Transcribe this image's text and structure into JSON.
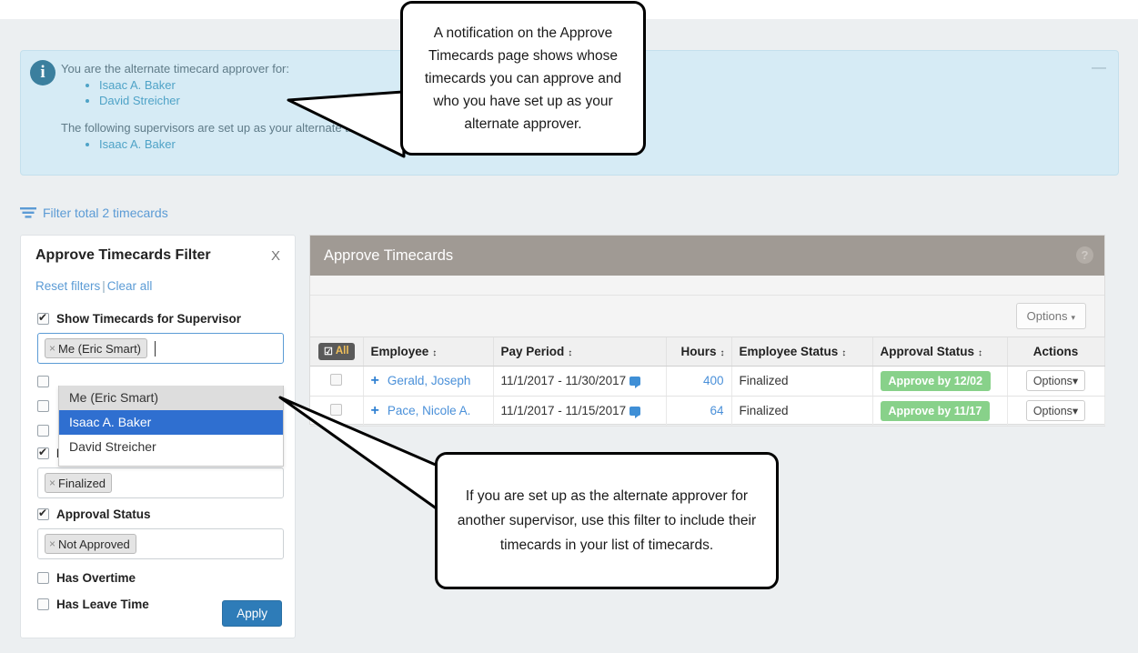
{
  "notification": {
    "icon": "info-icon",
    "lead_text": "You are the alternate timecard approver for:",
    "approver_for": [
      "Isaac A. Baker",
      "David Streicher"
    ],
    "second_lead_text": "The following supervisors are set up as your alternate timecard approver:",
    "alternate_approvers": [
      "Isaac A. Baker"
    ],
    "minimize_label": "—"
  },
  "filter_link": {
    "label": "Filter total 2 timecards",
    "icon": "funnel-icon"
  },
  "filter_panel": {
    "title": "Approve Timecards Filter",
    "close_label": "X",
    "reset_label": "Reset filters",
    "separator": "|",
    "clear_label": "Clear all",
    "supervisor": {
      "label": "Show Timecards for Supervisor",
      "checked": true,
      "tag": "Me (Eric Smart)",
      "tag_remove": "×",
      "options": [
        {
          "label": "Me (Eric Smart)",
          "state": "hover"
        },
        {
          "label": "Isaac A. Baker",
          "state": "selected"
        },
        {
          "label": "David Streicher",
          "state": "normal"
        }
      ]
    },
    "hidden_rows": [
      {
        "label": "",
        "checked": false
      },
      {
        "label": "",
        "checked": false
      },
      {
        "label": "",
        "checked": false
      }
    ],
    "employee_status": {
      "label": "Employee Status",
      "checked": true,
      "tag": "Finalized",
      "tag_remove": "×"
    },
    "approval_status": {
      "label": "Approval Status",
      "checked": true,
      "tag": "Not Approved",
      "tag_remove": "×"
    },
    "has_overtime": {
      "label": "Has Overtime",
      "checked": false
    },
    "has_leave_time": {
      "label": "Has Leave Time",
      "checked": false
    },
    "apply_label": "Apply"
  },
  "card": {
    "title": "Approve Timecards",
    "help_icon": "?",
    "options_label": "Options",
    "options_caret": "▾",
    "select_all_label": "All",
    "columns": [
      {
        "key": "select",
        "label": "",
        "sortable": false
      },
      {
        "key": "employee",
        "label": "Employee",
        "sortable": true
      },
      {
        "key": "pay_period",
        "label": "Pay Period",
        "sortable": true
      },
      {
        "key": "hours",
        "label": "Hours",
        "sortable": true
      },
      {
        "key": "employee_status",
        "label": "Employee Status",
        "sortable": true
      },
      {
        "key": "approval_status",
        "label": "Approval Status",
        "sortable": true
      },
      {
        "key": "actions",
        "label": "Actions",
        "sortable": false
      }
    ],
    "sort_glyph": "↕",
    "rows": [
      {
        "employee": "Gerald, Joseph",
        "pay_period": "11/1/2017 - 11/30/2017",
        "has_comment": true,
        "hours": "400",
        "employee_status": "Finalized",
        "approval_status": "Approve by 12/02",
        "action_label": "Options",
        "action_caret": "▾"
      },
      {
        "employee": "Pace, Nicole A.",
        "pay_period": "11/1/2017 - 11/15/2017",
        "has_comment": true,
        "hours": "64",
        "employee_status": "Finalized",
        "approval_status": "Approve by 11/17",
        "action_label": "Options",
        "action_caret": "▾"
      }
    ]
  },
  "callouts": [
    {
      "text": "A notification on the Approve Timecards page shows whose timecards you can approve and who you have set up as your alternate approver."
    },
    {
      "text": "If you are set up as the alternate approver for another supervisor, use this filter to include their timecards in your list of timecards."
    }
  ],
  "colors": {
    "page_background": "#eceff1",
    "notification_background": "#d6ebf5",
    "link_blue": "#4a90d9",
    "card_header": "#a09a94",
    "badge_green": "#88d18a",
    "apply_blue": "#2e7cb8",
    "dropdown_selected": "#2f6fd0"
  }
}
